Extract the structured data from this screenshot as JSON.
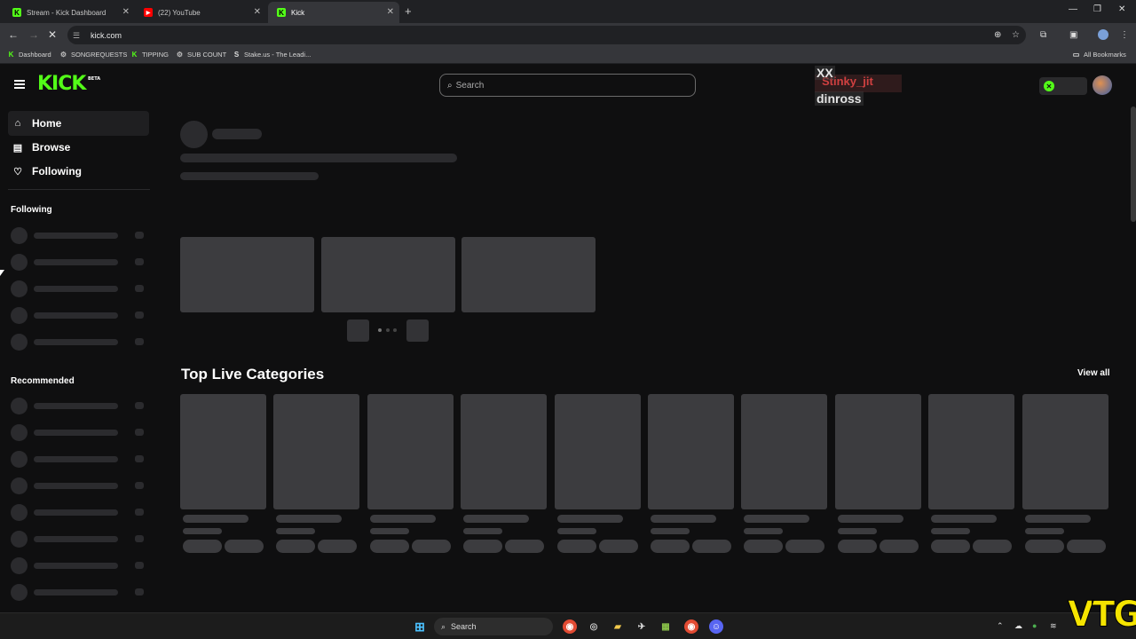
{
  "browser": {
    "tabs": [
      {
        "title": "Stream - Kick Dashboard",
        "icon": "kick-icon",
        "color": "#53fc18",
        "active": false
      },
      {
        "title": "(22) YouTube",
        "icon": "youtube-icon",
        "color": "#ff0000",
        "active": false
      },
      {
        "title": "Kick",
        "icon": "kick-icon",
        "color": "#53fc18",
        "active": true
      }
    ],
    "new_tab": "+",
    "url": "kick.com",
    "bookmarks": [
      {
        "label": "Dashboard",
        "icon": "kick-icon"
      },
      {
        "label": "SONGREQUESTS",
        "icon": "streamelements-icon"
      },
      {
        "label": "TIPPING",
        "icon": "kick-icon"
      },
      {
        "label": "SUB COUNT",
        "icon": "streamelements-icon"
      },
      {
        "label": "Stake.us - The Leadi...",
        "icon": "stake-icon"
      }
    ],
    "all_bookmarks": "All Bookmarks"
  },
  "site": {
    "logo": "KICK",
    "logo_badge": "BETA",
    "brand_color": "#53fc18",
    "search_placeholder": "Search"
  },
  "overlay": {
    "line_red": "Stinky_jit",
    "line_xx": "XX",
    "line_name": "dinross"
  },
  "sidebar": {
    "nav": [
      {
        "label": "Home",
        "icon": "home-icon",
        "active": true
      },
      {
        "label": "Browse",
        "icon": "browse-icon",
        "active": false
      },
      {
        "label": "Following",
        "icon": "heart-icon",
        "active": false
      }
    ],
    "following_title": "Following",
    "recommended_title": "Recommended"
  },
  "main": {
    "top_categories_title": "Top Live Categories",
    "view_all": "View all"
  },
  "taskbar": {
    "search_label": "Search"
  },
  "watermark": "VTG"
}
